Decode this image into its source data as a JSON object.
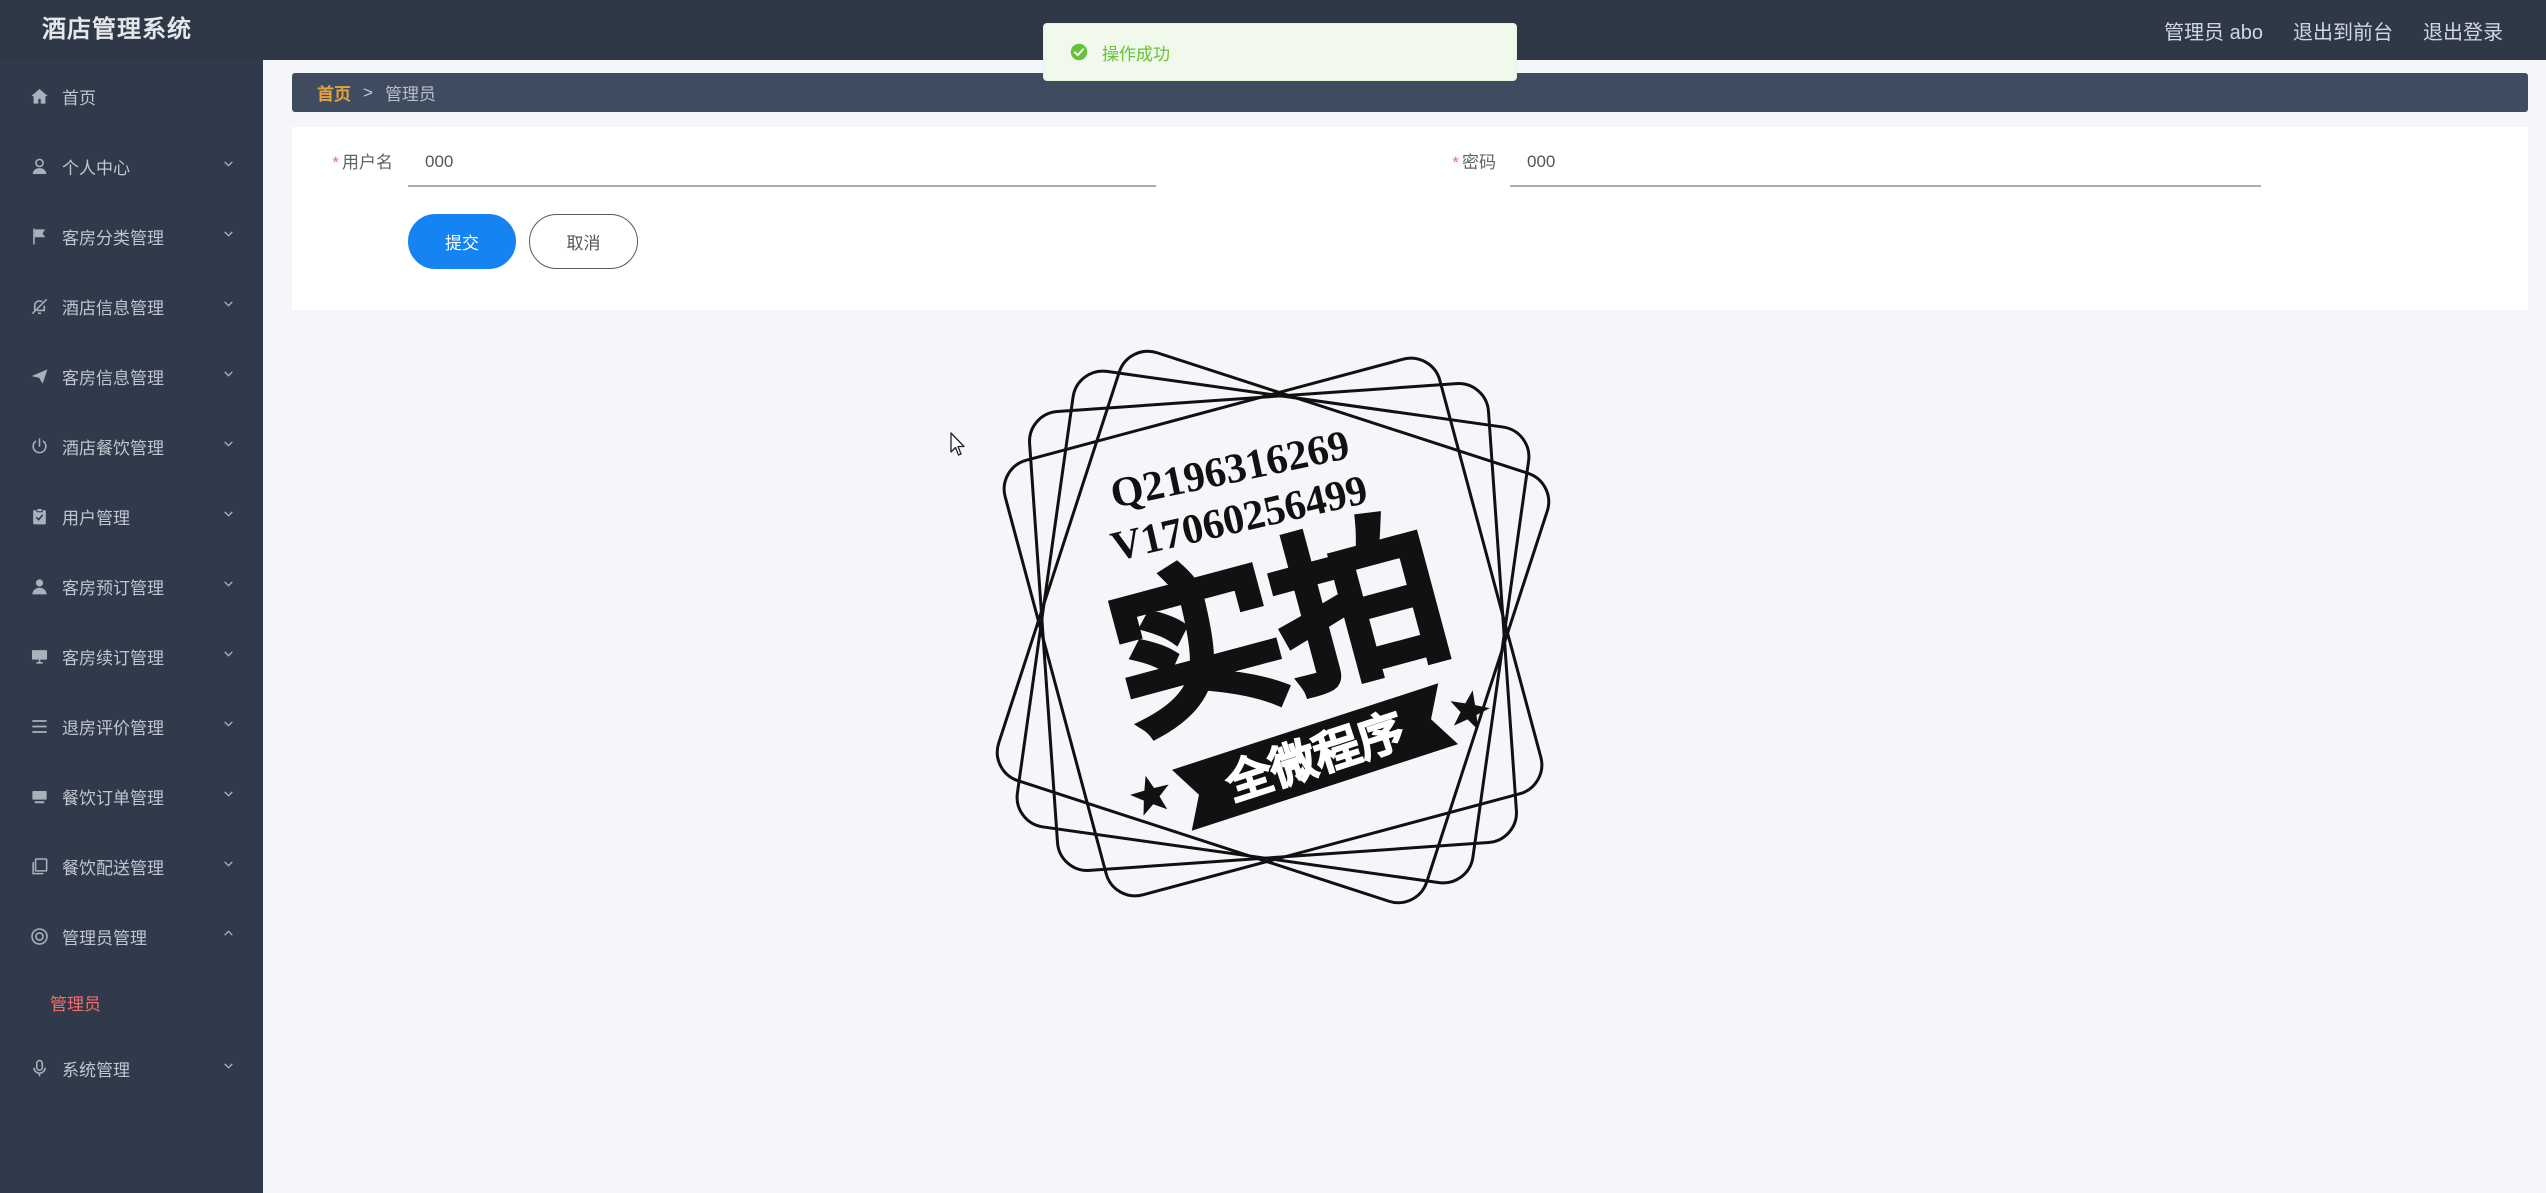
{
  "app": {
    "title": "酒店管理系统"
  },
  "header": {
    "user_label": "管理员 abo",
    "to_front_label": "退出到前台",
    "logout_label": "退出登录"
  },
  "toast": {
    "message": "操作成功",
    "icon": "check-circle-icon"
  },
  "sidebar": {
    "items": [
      {
        "label": "首页",
        "icon": "home-icon"
      },
      {
        "label": "个人中心",
        "icon": "user-icon",
        "expanded": false
      },
      {
        "label": "客房分类管理",
        "icon": "flag-icon",
        "expanded": false
      },
      {
        "label": "酒店信息管理",
        "icon": "bell-off-icon",
        "expanded": false
      },
      {
        "label": "客房信息管理",
        "icon": "send-icon",
        "expanded": false
      },
      {
        "label": "酒店餐饮管理",
        "icon": "power-icon",
        "expanded": false
      },
      {
        "label": "用户管理",
        "icon": "clipboard-icon",
        "expanded": false
      },
      {
        "label": "客房预订管理",
        "icon": "user-solid-icon",
        "expanded": false
      },
      {
        "label": "客房续订管理",
        "icon": "monitor-icon",
        "expanded": false
      },
      {
        "label": "退房评价管理",
        "icon": "menu-icon",
        "expanded": false
      },
      {
        "label": "餐饮订单管理",
        "icon": "platform-icon",
        "expanded": false
      },
      {
        "label": "餐饮配送管理",
        "icon": "copy-icon",
        "expanded": false
      },
      {
        "label": "管理员管理",
        "icon": "help-icon",
        "expanded": true,
        "children": [
          {
            "label": "管理员",
            "active": true
          }
        ]
      },
      {
        "label": "系统管理",
        "icon": "microphone-icon",
        "expanded": false
      }
    ]
  },
  "breadcrumb": {
    "home": "首页",
    "separator": ">",
    "current": "管理员"
  },
  "form": {
    "required_mark": "*",
    "fields": [
      {
        "label": "用户名",
        "value": "000",
        "required": true
      },
      {
        "label": "密码",
        "value": "000",
        "required": true
      }
    ],
    "submit_label": "提交",
    "cancel_label": "取消"
  },
  "watermark": {
    "line1": "Q2196316269",
    "line2": "V17060256499",
    "headline": "实拍",
    "ribbon": "全微程序"
  },
  "colors": {
    "header_bg": "#2e3847",
    "sidebar_bg": "#303a4a",
    "content_bg": "#f4f6f9",
    "breadcrumb_bg": "#3f4b5f",
    "breadcrumb_home": "#e6a23c",
    "primary": "#1584f2",
    "active_menu": "#f56c6c",
    "required": "#f56c6c",
    "success": "#67c23a"
  }
}
